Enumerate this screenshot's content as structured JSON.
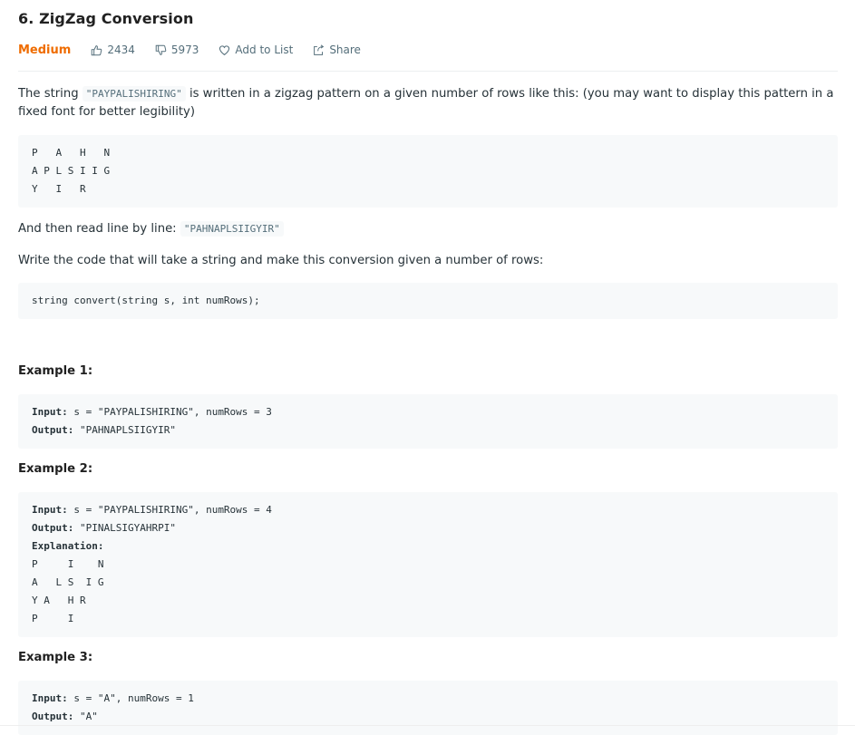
{
  "problem": {
    "title": "6. ZigZag Conversion",
    "difficulty": "Medium",
    "likes": "2434",
    "dislikes": "5973",
    "add_to_list": "Add to List",
    "share": "Share"
  },
  "description": {
    "intro_before": "The string ",
    "intro_code": "\"PAYPALISHIRING\"",
    "intro_after": " is written in a zigzag pattern on a given number of rows like this: (you may want to display this pattern in a fixed font for better legibility)",
    "pattern": [
      "P   A   H   N",
      "A P L S I I G",
      "Y   I   R"
    ],
    "read_before": "And then read line by line: ",
    "read_code": "\"PAHNAPLSIIGYIR\"",
    "write_text": "Write the code that will take a string and make this conversion given a number of rows:",
    "signature": "string convert(string s, int numRows);"
  },
  "examples": [
    {
      "heading": "Example 1:",
      "input_label": "Input:",
      "input_value": " s = \"PAYPALISHIRING\", numRows = 3",
      "output_label": "Output:",
      "output_value": " \"PAHNAPLSIIGYIR\""
    },
    {
      "heading": "Example 2:",
      "input_label": "Input:",
      "input_value": " s = \"PAYPALISHIRING\", numRows = 4",
      "output_label": "Output:",
      "output_value": " \"PINALSIGYAHRPI\"",
      "explanation_label": "Explanation:",
      "explanation_lines": [
        "P     I    N",
        "A   L S  I G",
        "Y A   H R",
        "P     I"
      ]
    },
    {
      "heading": "Example 3:",
      "input_label": "Input:",
      "input_value": " s = \"A\", numRows = 1",
      "output_label": "Output:",
      "output_value": " \"A\""
    }
  ],
  "icons": {
    "like": "thumbs-up-icon",
    "dislike": "thumbs-down-icon",
    "favorite": "heart-icon",
    "share": "share-icon"
  },
  "colors": {
    "difficulty": "#ef6c00",
    "code_bg": "#f7f9fa",
    "meta_text": "#546e7a"
  }
}
